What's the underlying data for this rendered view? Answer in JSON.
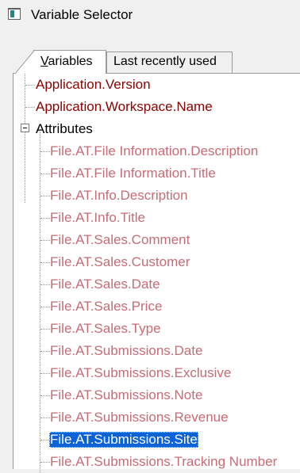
{
  "window": {
    "title": "Variable Selector",
    "icon": "window-app-icon"
  },
  "tabs": [
    {
      "label": "Variables",
      "accel": "V",
      "rest": "ariables",
      "selected": true
    },
    {
      "label": "Last recently used",
      "selected": false
    }
  ],
  "tree": {
    "roots": [
      "Application.Version",
      "Application.Workspace.Name"
    ],
    "group": {
      "label": "Attributes",
      "expanded": true,
      "children": [
        "File.AT.File Information.Description",
        "File.AT.File Information.Title",
        "File.AT.Info.Description",
        "File.AT.Info.Title",
        "File.AT.Sales.Comment",
        "File.AT.Sales.Customer",
        "File.AT.Sales.Date",
        "File.AT.Sales.Price",
        "File.AT.Sales.Type",
        "File.AT.Submissions.Date",
        "File.AT.Submissions.Exclusive",
        "File.AT.Submissions.Note",
        "File.AT.Submissions.Revenue",
        "File.AT.Submissions.Site",
        "File.AT.Submissions.Tracking Number"
      ],
      "selected_index": 13
    }
  },
  "colors": {
    "root_item": "#8b0000",
    "child_item": "#c76b74",
    "selection": "#0a62d6"
  }
}
